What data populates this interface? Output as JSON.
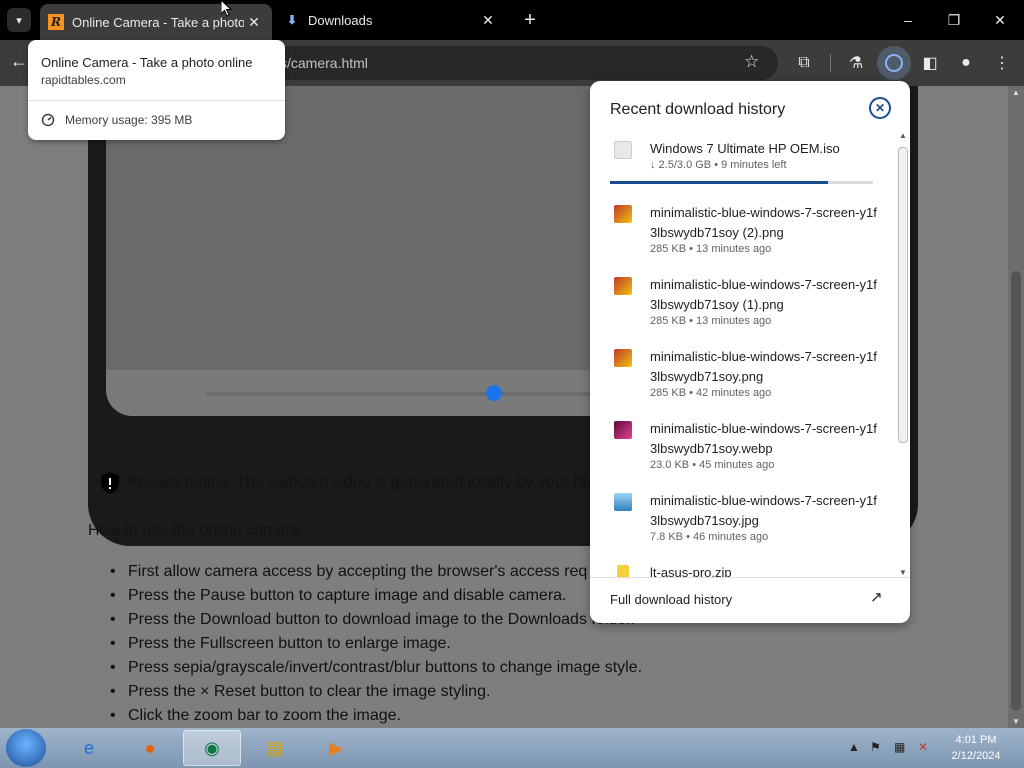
{
  "tabs": [
    {
      "title": "Online Camera - Take a photo online",
      "favicon": "rapidtables-r-icon"
    },
    {
      "title": "Downloads",
      "favicon": "download-icon"
    }
  ],
  "tab_search_icon": "▾",
  "new_tab_icon": "+",
  "window_controls": {
    "minimize": "–",
    "maximize": "❐",
    "close": "✕"
  },
  "omnibox": {
    "url": "s/camera.html"
  },
  "toolbar_icons": {
    "star": "☆",
    "extensions": "⧉",
    "labs": "⚗",
    "sidepanel": "◧",
    "profile": "●",
    "menu": "⋮"
  },
  "hover_card": {
    "title": "Online Camera - Take a photo online",
    "domain": "rapidtables.com",
    "memory": "Memory usage: 395 MB"
  },
  "page": {
    "privacy_notice": "Privacy notice: The webcam video is generated locally by your bro",
    "howto_title": "How to use the online camera:",
    "steps": [
      "First allow camera access by accepting the browser's access req",
      "Press the Pause button to capture image and disable camera.",
      "Press the Download button to download image to the Downloads folder.",
      "Press the Fullscreen button to enlarge image.",
      "Press sepia/grayscale/invert/contrast/blur buttons to change image style.",
      "Press the × Reset button to clear the image styling.",
      "Click the zoom bar to zoom the image."
    ],
    "zoom_level": 0.5
  },
  "downloads": {
    "heading": "Recent download history",
    "close_icon": "✕",
    "items": [
      {
        "name": "Windows 7 Ultimate HP OEM.iso",
        "meta": "↓ 2.5/3.0 GB • 9 minutes left",
        "icon": "file-icon",
        "progress": 0.83
      },
      {
        "name": "minimalistic-blue-windows-7-screen-y1f3lbswydb71soy (2).png",
        "meta": "285 KB • 13 minutes ago",
        "icon": "image-icon"
      },
      {
        "name": "minimalistic-blue-windows-7-screen-y1f3lbswydb71soy (1).png",
        "meta": "285 KB • 13 minutes ago",
        "icon": "image-icon"
      },
      {
        "name": "minimalistic-blue-windows-7-screen-y1f3lbswydb71soy.png",
        "meta": "285 KB • 42 minutes ago",
        "icon": "image-icon"
      },
      {
        "name": "minimalistic-blue-windows-7-screen-y1f3lbswydb71soy.webp",
        "meta": "23.0 KB • 45 minutes ago",
        "icon": "webp-icon"
      },
      {
        "name": "minimalistic-blue-windows-7-screen-y1f3lbswydb71soy.jpg",
        "meta": "7.8 KB • 46 minutes ago",
        "icon": "jpg-icon"
      },
      {
        "name": "lt-asus-pro.zip",
        "meta": "",
        "icon": "zip-icon"
      }
    ],
    "full_history": "Full download history",
    "open_icon": "↗"
  },
  "taskbar": {
    "clock_time": "4:01 PM",
    "clock_date": "2/12/2024",
    "tray_arrow": "▲",
    "apps": [
      "internet-explorer-icon",
      "firefox-icon",
      "chrome-icon",
      "explorer-icon",
      "media-player-icon"
    ]
  }
}
